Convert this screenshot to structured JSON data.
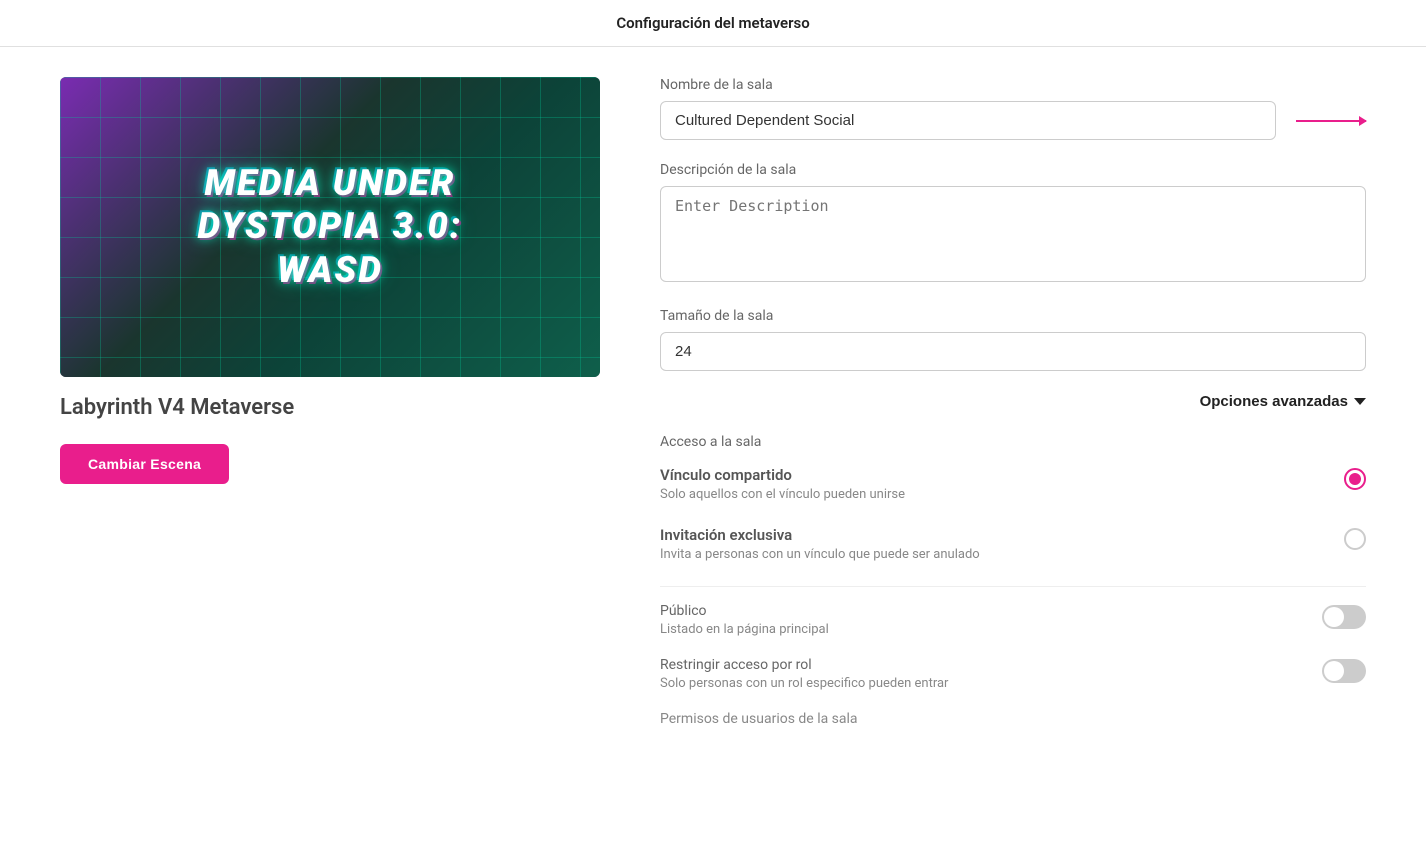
{
  "header": {
    "title": "Configuración del metaverso"
  },
  "left": {
    "scene_text": "MEDIA UNDER\nDYSTOPIA 3.0:\nWASD",
    "room_name": "Labyrinth V4 Metaverse",
    "change_scene_label": "Cambiar Escena"
  },
  "right": {
    "room_name_label": "Nombre de la sala",
    "room_name_value": "Cultured Dependent Social",
    "room_desc_label": "Descripción de la sala",
    "room_desc_placeholder": "Enter Description",
    "room_size_label": "Tamaño de la sala",
    "room_size_value": "24",
    "advanced_options_label": "Opciones avanzadas",
    "access_label": "Acceso a la sala",
    "shared_link_title": "Vínculo compartido",
    "shared_link_desc": "Solo aquellos con el vínculo pueden unirse",
    "exclusive_invite_title": "Invitación exclusiva",
    "exclusive_invite_desc": "Invita a personas con un vínculo que puede ser anulado",
    "public_title": "Público",
    "public_desc": "Listado en la página principal",
    "restrict_role_title": "Restringir acceso por rol",
    "restrict_role_desc": "Solo personas con un rol especifico pueden entrar",
    "room_users_perm_title": "Permisos de usuarios de la sala"
  }
}
